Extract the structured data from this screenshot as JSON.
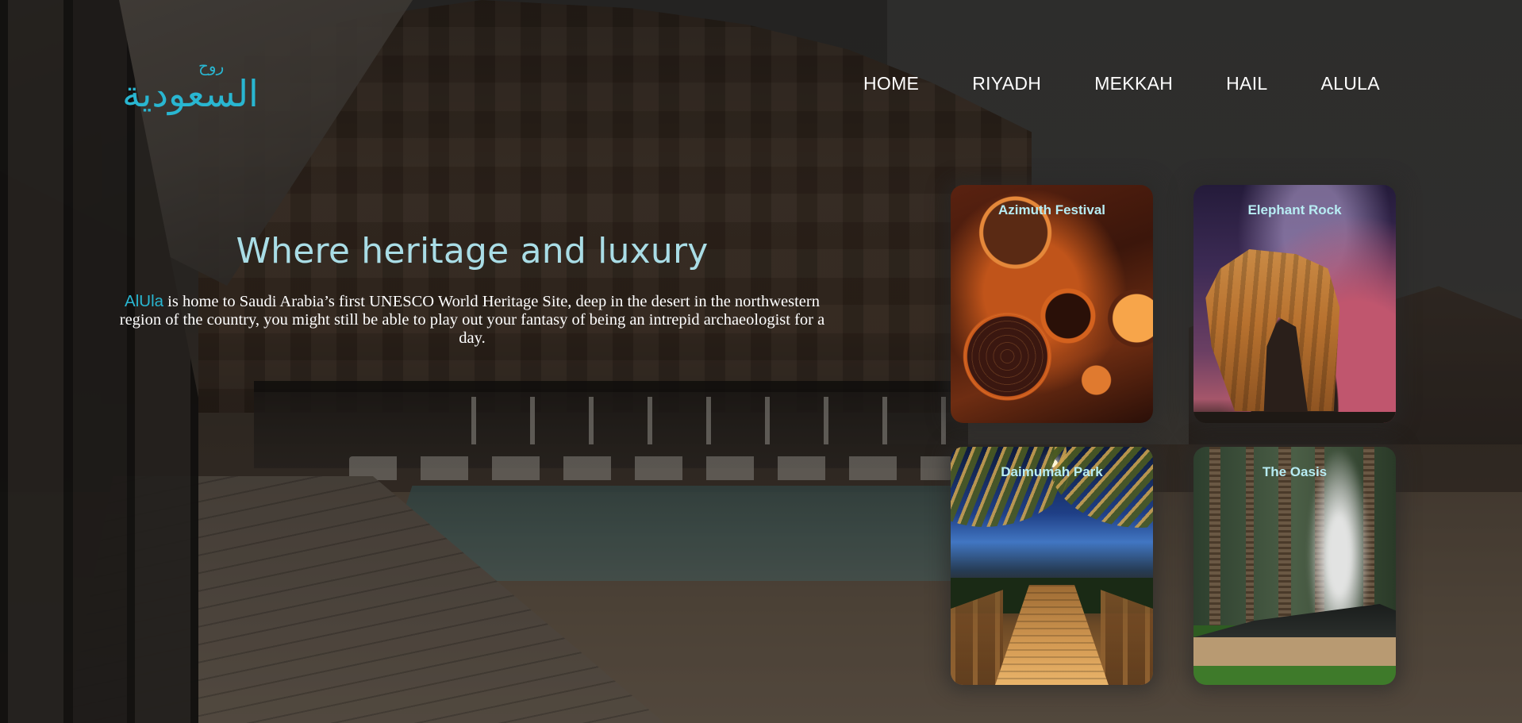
{
  "brand": {
    "logo_text_small": "روح",
    "logo_text_large": "السعودية",
    "logo_color": "#29b6d1"
  },
  "nav": {
    "items": [
      {
        "label": "HOME"
      },
      {
        "label": "RIYADH"
      },
      {
        "label": "MEKKAH"
      },
      {
        "label": "HAIL"
      },
      {
        "label": "ALULA"
      }
    ]
  },
  "hero": {
    "title": "Where heritage and luxury",
    "accent_word": "AlUla",
    "description": " is home to Saudi Arabia’s first UNESCO World Heritage Site, deep in the desert in the northwestern region of the country, you might still be able to play out your fantasy of being an intrepid archaeologist for a day.",
    "title_color": "#a9dde6",
    "accent_color": "#29b6d1"
  },
  "cards": [
    {
      "title": "Azimuth Festival",
      "image": "azimuth-festival-aerial-photo"
    },
    {
      "title": "Elephant Rock",
      "image": "elephant-rock-night-photo"
    },
    {
      "title": "Daimumah Park",
      "image": "daimumah-park-bridge-photo"
    },
    {
      "title": "The Oasis",
      "image": "oasis-palm-grove-photo"
    }
  ]
}
